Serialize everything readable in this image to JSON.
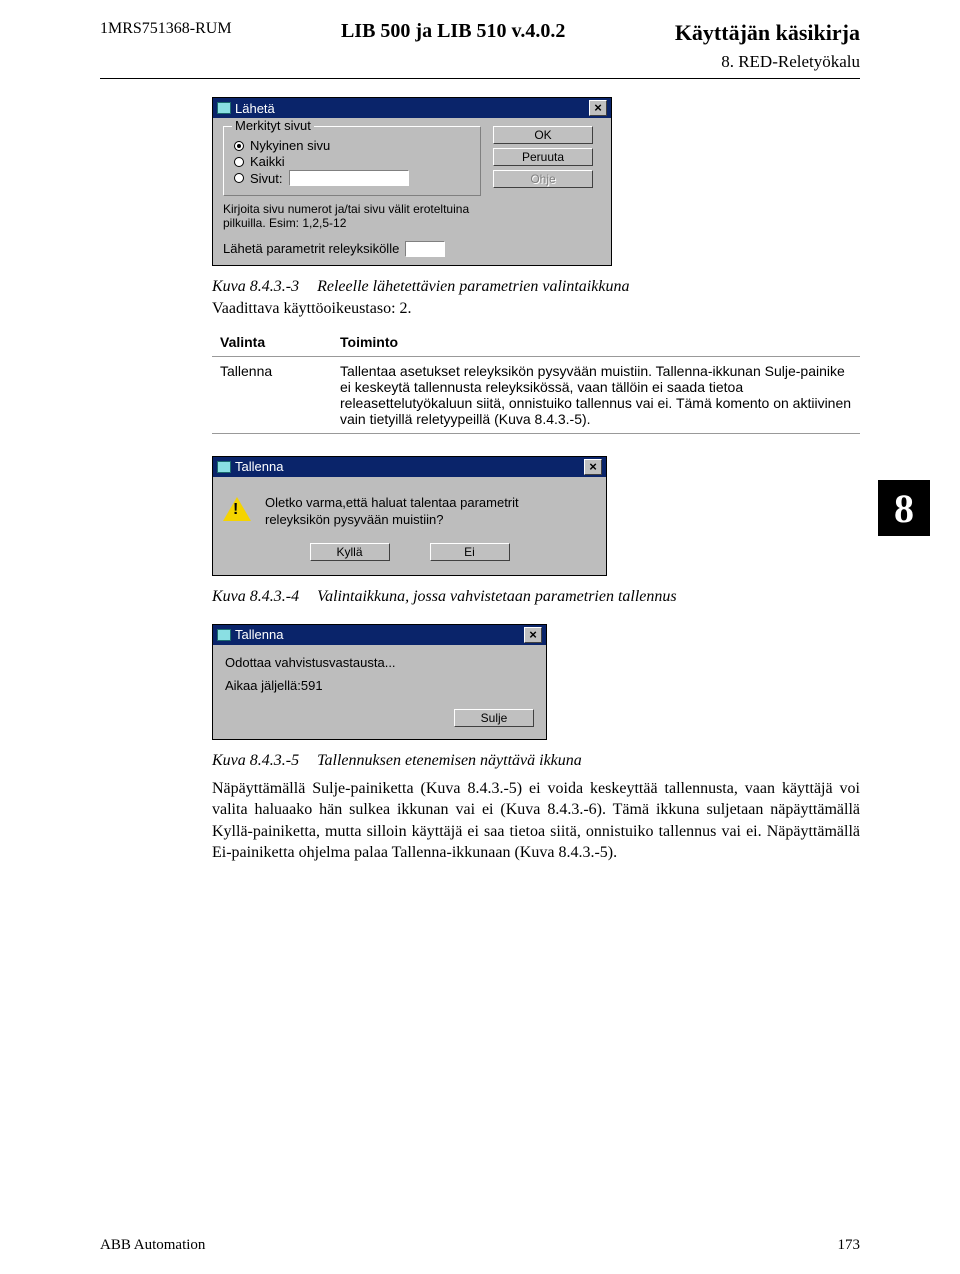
{
  "header": {
    "doc_id": "1MRS751368-RUM",
    "product": "LIB 500 ja LIB 510 v.4.0.2",
    "title": "Käyttäjän käsikirja",
    "section": "8. RED-Reletyökalu"
  },
  "dialog1": {
    "title": "Lähetä",
    "group_legend": "Merkityt sivut",
    "opt_current": "Nykyinen sivu",
    "opt_all": "Kaikki",
    "opt_pages": "Sivut:",
    "hint": "Kirjoita sivu numerot ja/tai sivu välit eroteltuina pilkuilla. Esim: 1,2,5-12",
    "bottom_label": "Lähetä parametrit releyksikölle",
    "btn_ok": "OK",
    "btn_cancel": "Peruuta",
    "btn_help": "Ohje"
  },
  "caption1": {
    "num": "Kuva 8.4.3.-3",
    "text": "Releelle lähetettävien parametrien valintaikkuna"
  },
  "perm_level": "Vaadittava käyttöoikeustaso: 2.",
  "table": {
    "head_sel": "Valinta",
    "head_fn": "Toiminto",
    "row1_sel": "Tallenna",
    "row1_fn": "Tallentaa asetukset releyksikön pysyvään muistiin. Tallenna-ikkunan Sulje-painike ei keskeytä tallennusta releyksikössä, vaan tällöin ei saada tietoa releasettelutyökaluun siitä, onnistuiko tallennus vai ei. Tämä komento on aktiivinen vain tietyillä reletyypeillä (Kuva 8.4.3.-5)."
  },
  "chapter_num": "8",
  "dialog2": {
    "title": "Tallenna",
    "msg": "Oletko varma,että haluat talentaa parametrit releyksikön pysyvään muistiin?",
    "btn_yes": "Kyllä",
    "btn_no": "Ei"
  },
  "caption2": {
    "num": "Kuva 8.4.3.-4",
    "text": "Valintaikkuna, jossa vahvistetaan parametrien tallennus"
  },
  "dialog3": {
    "title": "Tallenna",
    "line1": "Odottaa vahvistusvastausta...",
    "line2": "Aikaa jäljellä:591",
    "btn_close": "Sulje"
  },
  "caption3": {
    "num": "Kuva 8.4.3.-5",
    "text": "Tallennuksen etenemisen näyttävä ikkuna"
  },
  "body_para": "Näpäyttämällä Sulje-painiketta (Kuva 8.4.3.-5) ei voida keskeyttää tallennusta, vaan käyttäjä voi valita haluaako hän sulkea ikkunan vai ei (Kuva 8.4.3.-6). Tämä ikkuna suljetaan näpäyttämällä Kyllä-painiketta, mutta silloin käyttäjä ei saa tietoa siitä, onnistuiko tallennus vai ei. Näpäyttämällä Ei-painiketta ohjelma palaa Tallenna-ikkunaan (Kuva 8.4.3.-5).",
  "footer": {
    "left": "ABB Automation",
    "page": "173"
  }
}
